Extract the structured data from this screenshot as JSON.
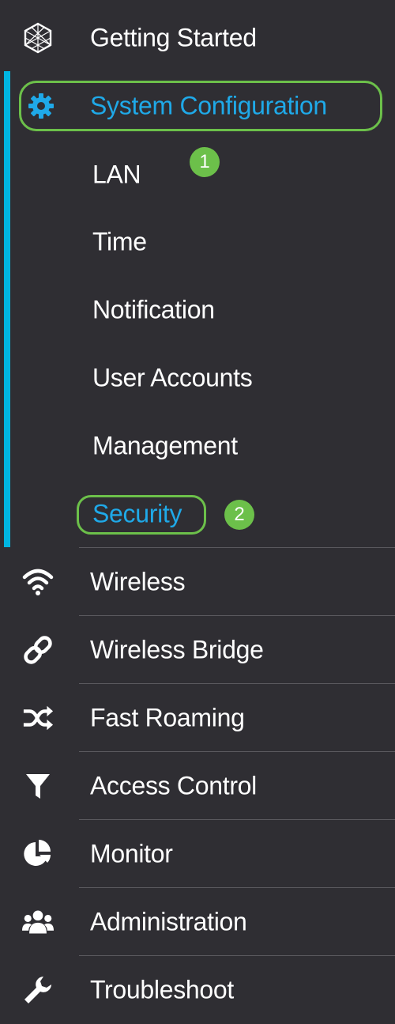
{
  "menu": {
    "getting_started": {
      "label": "Getting Started",
      "icon": "hexagon-mesh-icon"
    },
    "system_configuration": {
      "label": "System Configuration",
      "icon": "gear-icon",
      "active": true,
      "subitems": [
        {
          "label": "LAN"
        },
        {
          "label": "Time"
        },
        {
          "label": "Notification"
        },
        {
          "label": "User Accounts"
        },
        {
          "label": "Management"
        },
        {
          "label": "Security",
          "selected": true
        }
      ]
    },
    "items": [
      {
        "label": "Wireless",
        "icon": "wifi-icon"
      },
      {
        "label": "Wireless Bridge",
        "icon": "link-icon"
      },
      {
        "label": "Fast Roaming",
        "icon": "shuffle-icon"
      },
      {
        "label": "Access Control",
        "icon": "filter-icon"
      },
      {
        "label": "Monitor",
        "icon": "pie-chart-icon"
      },
      {
        "label": "Administration",
        "icon": "users-icon"
      },
      {
        "label": "Troubleshoot",
        "icon": "wrench-icon"
      }
    ]
  },
  "annotations": {
    "step1": "1",
    "step2": "2"
  },
  "colors": {
    "background": "#2f2e33",
    "accent": "#1fa9e8",
    "active_bar": "#00b5e2",
    "highlight": "#6cc04a"
  }
}
